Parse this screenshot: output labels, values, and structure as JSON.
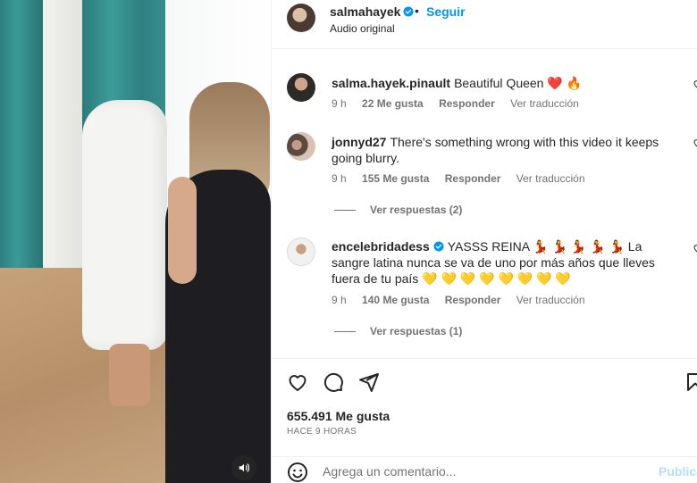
{
  "header": {
    "username": "salmahayek",
    "dot": "•",
    "follow_label": "Seguir",
    "audio": "Audio original"
  },
  "comments": [
    {
      "username": "salma.hayek.pinault",
      "text": "Beautiful Queen ❤️ 🔥",
      "time": "9 h",
      "likes": "22 Me gusta",
      "reply": "Responder",
      "translate": "Ver traducción"
    },
    {
      "username": "jonnyd27",
      "text": "There's something wrong with this video it keeps going blurry.",
      "time": "9 h",
      "likes": "155 Me gusta",
      "reply": "Responder",
      "translate": "Ver traducción",
      "replies": "Ver respuestas (2)"
    },
    {
      "username": "encelebridadess",
      "text": "YASSS REINA 💃 💃 💃 💃 💃 La sangre latina nunca se va de uno por más años que lleves fuera de tu país 💛 💛 💛 💛 💛 💛 💛 💛",
      "time": "9 h",
      "likes": "140 Me gusta",
      "reply": "Responder",
      "translate": "Ver traducción",
      "replies": "Ver respuestas (1)"
    }
  ],
  "post": {
    "likes": "655.491 Me gusta",
    "time_ago": "HACE 9 HORAS"
  },
  "add_comment": {
    "placeholder": "Agrega un comentario...",
    "publish_label": "Publicar"
  },
  "icons": {
    "header_verified": "verified-badge-icon",
    "sound": "speaker-icon",
    "like": "heart-icon",
    "comment": "comment-bubble-icon",
    "share": "paper-plane-icon",
    "save": "bookmark-icon",
    "emoji": "smiley-icon"
  },
  "colors": {
    "link_blue": "#0095f6",
    "muted": "#737373",
    "text": "#262626"
  }
}
